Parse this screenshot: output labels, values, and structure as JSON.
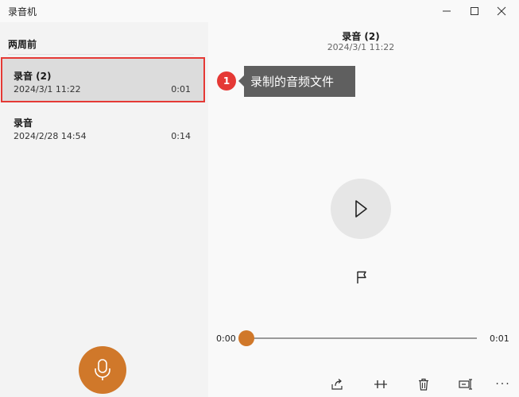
{
  "app": {
    "title": "录音机"
  },
  "window_controls": {
    "minimize_icon": "minimize-icon",
    "maximize_icon": "maximize-icon",
    "close_icon": "close-icon"
  },
  "sidebar": {
    "section_header": "两周前",
    "recordings": [
      {
        "name": "录音 (2)",
        "date": "2024/3/1 11:22",
        "duration": "0:01",
        "selected": true
      },
      {
        "name": "录音",
        "date": "2024/2/28 14:54",
        "duration": "0:14",
        "selected": false
      }
    ],
    "record_button_icon": "microphone-icon"
  },
  "annotation": {
    "number": "1",
    "text": "录制的音频文件"
  },
  "detail": {
    "title": "录音 (2)",
    "date": "2024/3/1 11:22",
    "play_icon": "play-icon",
    "marker_icon": "flag-icon"
  },
  "playback": {
    "current_time": "0:00",
    "total_time": "0:01",
    "progress": 0
  },
  "toolbar": {
    "share_icon": "share-icon",
    "trim_icon": "trim-icon",
    "delete_icon": "delete-icon",
    "rename_icon": "rename-icon",
    "more_label": "···"
  },
  "colors": {
    "accent": "#d0782a",
    "highlight": "#e53935",
    "callout": "#5f5f5f",
    "sidebar_bg": "#f3f3f3",
    "selected_bg": "#dcdcdc"
  }
}
